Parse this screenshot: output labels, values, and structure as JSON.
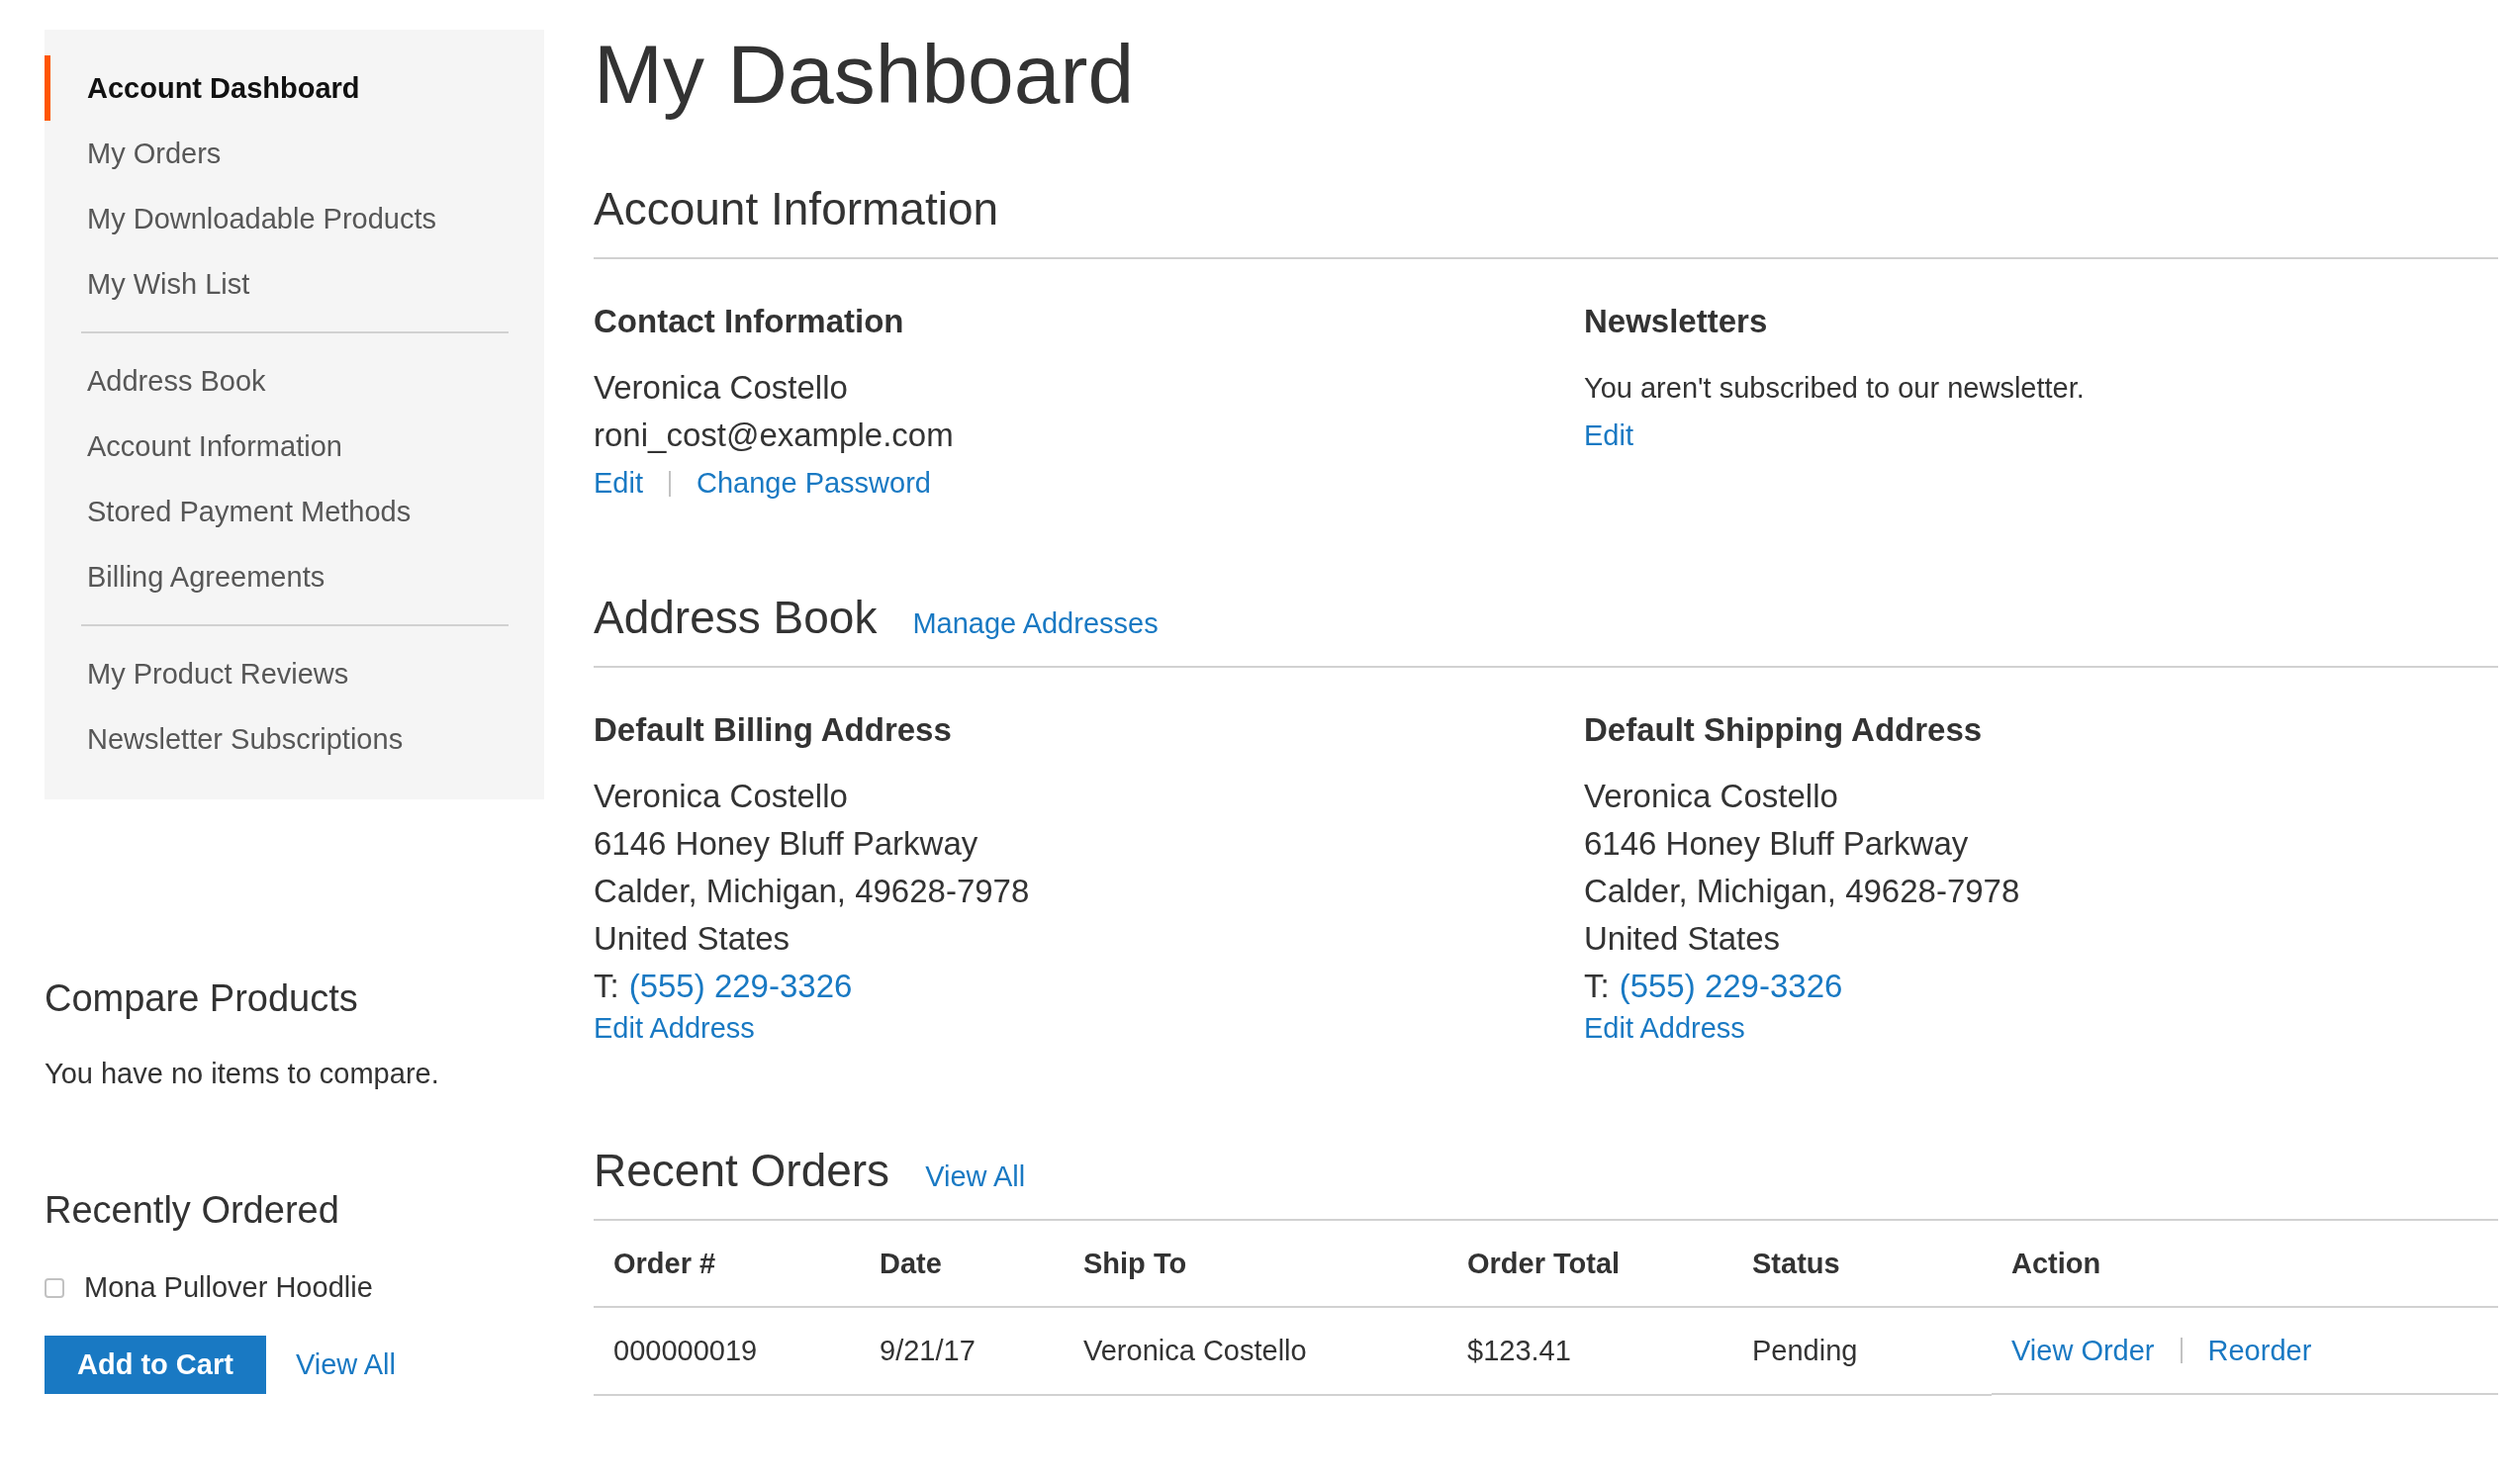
{
  "sidebar": {
    "nav_groups": [
      [
        {
          "label": "Account Dashboard",
          "selected": true
        },
        {
          "label": "My Orders",
          "selected": false
        },
        {
          "label": "My Downloadable Products",
          "selected": false
        },
        {
          "label": "My Wish List",
          "selected": false
        }
      ],
      [
        {
          "label": "Address Book",
          "selected": false
        },
        {
          "label": "Account Information",
          "selected": false
        },
        {
          "label": "Stored Payment Methods",
          "selected": false
        },
        {
          "label": "Billing Agreements",
          "selected": false
        }
      ],
      [
        {
          "label": "My Product Reviews",
          "selected": false
        },
        {
          "label": "Newsletter Subscriptions",
          "selected": false
        }
      ]
    ],
    "compare": {
      "title": "Compare Products",
      "message": "You have no items to compare."
    },
    "recently_ordered": {
      "title": "Recently Ordered",
      "items": [
        {
          "name": "Mona Pullover Hoodlie",
          "checked": false
        }
      ],
      "add_button": "Add to Cart",
      "view_all": "View All"
    }
  },
  "page_title": "My Dashboard",
  "account_information": {
    "title": "Account Information",
    "contact": {
      "title": "Contact Information",
      "lines": [
        "Veronica Costello",
        "roni_cost@example.com"
      ],
      "links": [
        "Edit",
        "Change Password"
      ]
    },
    "newsletters": {
      "title": "Newsletters",
      "text": "You aren't subscribed to our newsletter.",
      "link": "Edit"
    }
  },
  "address_book": {
    "title": "Address Book",
    "link": "Manage Addresses",
    "addresses": [
      {
        "title": "Default Billing Address",
        "lines": [
          "Veronica Costello",
          "6146 Honey Bluff Parkway",
          "Calder, Michigan, 49628-7978",
          "United States"
        ],
        "phone_label": "T:",
        "phone": "(555) 229-3326",
        "link": "Edit Address"
      },
      {
        "title": "Default Shipping Address",
        "lines": [
          "Veronica Costello",
          "6146 Honey Bluff Parkway",
          "Calder, Michigan, 49628-7978",
          "United States"
        ],
        "phone_label": "T:",
        "phone": "(555) 229-3326",
        "link": "Edit Address"
      }
    ]
  },
  "recent_orders": {
    "title": "Recent Orders",
    "link": "View All",
    "table": {
      "columns": [
        "Order #",
        "Date",
        "Ship To",
        "Order Total",
        "Status",
        "Action"
      ],
      "rows": [
        {
          "cells": [
            "000000019",
            "9/21/17",
            "Veronica Costello",
            "$123.41",
            "Pending"
          ],
          "actions": [
            "View Order",
            "Reorder"
          ]
        }
      ]
    }
  }
}
